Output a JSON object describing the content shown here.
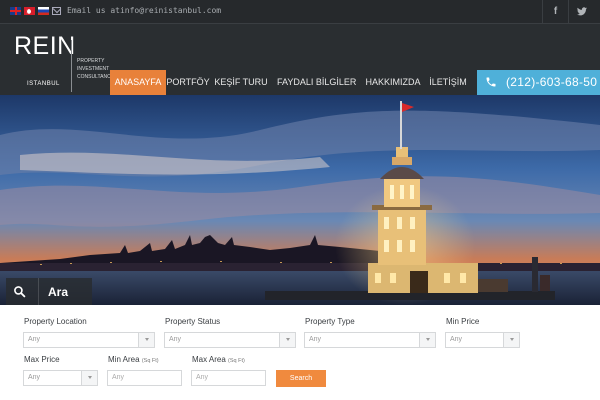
{
  "topbar": {
    "email": "Email us atinfo@reinistanbul.com",
    "facebook_glyph": "f",
    "twitter_glyph": "★",
    "flags": [
      "flag-uk-icon",
      "flag-tr-icon",
      "flag-ru-icon"
    ]
  },
  "brand": {
    "logo": "REIN",
    "city": "ISTANBUL",
    "tagline_1": "PROPERTY",
    "tagline_2": "INVESTMENT",
    "tagline_3": "CONSULTANCY"
  },
  "nav": {
    "items": [
      "ANASAYFA",
      "PORTFÖY",
      "KEŞİF TURU",
      "FAYDALI BİLGİLER",
      "HAKKIMIZDA",
      "İLETİŞİM"
    ],
    "phone": "(212)-603-68-50"
  },
  "colors": {
    "accent": "#e8813a",
    "phone_bg": "#4fb0d9",
    "header_bg": "#2a2e31"
  },
  "search": {
    "tab_label": "Ara",
    "property_location_label": "Property Location",
    "property_status_label": "Property Status",
    "property_type_label": "Property Type",
    "min_price_label": "Min Price",
    "max_price_label": "Max Price",
    "min_area_label": "Min Area",
    "max_area_label": "Max Area",
    "area_unit": "(Sq Ft)",
    "any": "Any",
    "button": "Search"
  }
}
